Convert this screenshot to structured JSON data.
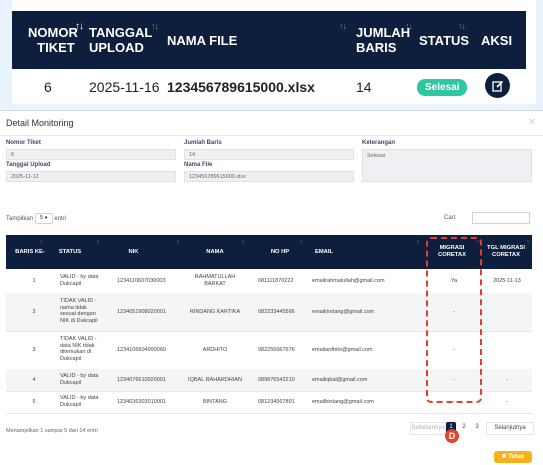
{
  "top_table": {
    "headers": {
      "nomor_tiket_1": "NOMOR",
      "nomor_tiket_2": "TIKET",
      "tanggal_upload_1": "TANGGAL",
      "tanggal_upload_2": "UPLOAD",
      "nama_file": "NAMA FILE",
      "jumlah_baris_1": "JUMLAH",
      "jumlah_baris_2": "BARIS",
      "status": "STATUS",
      "aksi": "AKSI"
    },
    "row": {
      "nomor_tiket": "6",
      "tanggal_upload": "2025-11-16",
      "nama_file": "123456789615000.xlsx",
      "jumlah_baris": "14",
      "status": "Selesai"
    }
  },
  "modal": {
    "title": "Detail Monitoring",
    "close": "×",
    "fields": {
      "nomor_tiket_label": "Nomor Tiket",
      "nomor_tiket_value": "6",
      "tanggal_upload_label": "Tanggal Upload",
      "tanggal_upload_value": "2025-11-12",
      "jumlah_baris_label": "Jumlah Baris",
      "jumlah_baris_value": "14",
      "nama_file_label": "Nama File",
      "nama_file_value": "123456789615000.xlsx",
      "keterangan_label": "Keterangan",
      "keterangan_value": "Selesai"
    },
    "length_menu": {
      "prefix": "Tampilkan",
      "value": "5 ♦",
      "suffix": "entri"
    },
    "search_label": "Cari:",
    "table": {
      "headers": {
        "baris_ke": "BARIS KE-",
        "status": "STATUS",
        "nik": "NIK",
        "nama": "NAMA",
        "no_hp": "NO HP",
        "email": "EMAIL",
        "migrasi_1": "MIGRASI",
        "migrasi_2": "CORETAX",
        "tgl_1": "TGL MIGRASI",
        "tgl_2": "CORETAX"
      },
      "rows": [
        {
          "baris": "1",
          "status": [
            "VALID - by data",
            "Dukcapil"
          ],
          "nik": "1234110607030003",
          "nama": [
            "RAHMATULLAH",
            "BARKAT"
          ],
          "hp": "081111870222",
          "email": "emailrahmatullah@gmail.com",
          "migrasi": "Ya",
          "tgl": "2025-11-13"
        },
        {
          "baris": "2",
          "status": [
            "TIDAK VALID -",
            "nama tidak",
            "sesuai dengan",
            "NIK di Dukcapil"
          ],
          "nik": "1234051908020001",
          "nama": [
            "RINDANG KARTIKA"
          ],
          "hp": "082233445566",
          "email": "emailrindang@gmail.com",
          "migrasi": "-",
          "tgl": ""
        },
        {
          "baris": "3",
          "status": [
            "TIDAK VALID -",
            "data NIK tidak",
            "ditemukan di",
            "Dukcapil"
          ],
          "nik": "1234106604990060",
          "nama": [
            "ARDHITO"
          ],
          "hp": "082255667676",
          "email": "emailardhito@gmail.com",
          "migrasi": "-",
          "tgl": ""
        },
        {
          "baris": "4",
          "status": [
            "VALID - by data",
            "Dukcapil"
          ],
          "nik": "1234076610020001",
          "nama": [
            "IQBAL RAHARDHIAN"
          ],
          "hp": "089876543210",
          "email": "emailiqbal@gmail.com",
          "migrasi": "-",
          "tgl": "-"
        },
        {
          "baris": "5",
          "status": [
            "VALID - by data",
            "Dukcapil"
          ],
          "nik": "1234036303010001",
          "nama": [
            "BINTANG"
          ],
          "hp": "081234567891",
          "email": "emailbintang@gmail.com",
          "migrasi": "-",
          "tgl": "-"
        }
      ]
    },
    "info": "Menampilkan 1 sampai 5 dari 14 entri",
    "pagination": {
      "prev": "Sebelumnya",
      "pages": [
        "1",
        "2",
        "3"
      ],
      "next": "Selanjutnya"
    },
    "annotation": "D",
    "close_button": "Tutup",
    "colors": {
      "header_bg": "#0d1f3d",
      "status_badge": "#2ec7a2",
      "highlight": "#e63c2f",
      "close_button": "#f6b21c",
      "active_page": "#0d1f3d"
    }
  }
}
